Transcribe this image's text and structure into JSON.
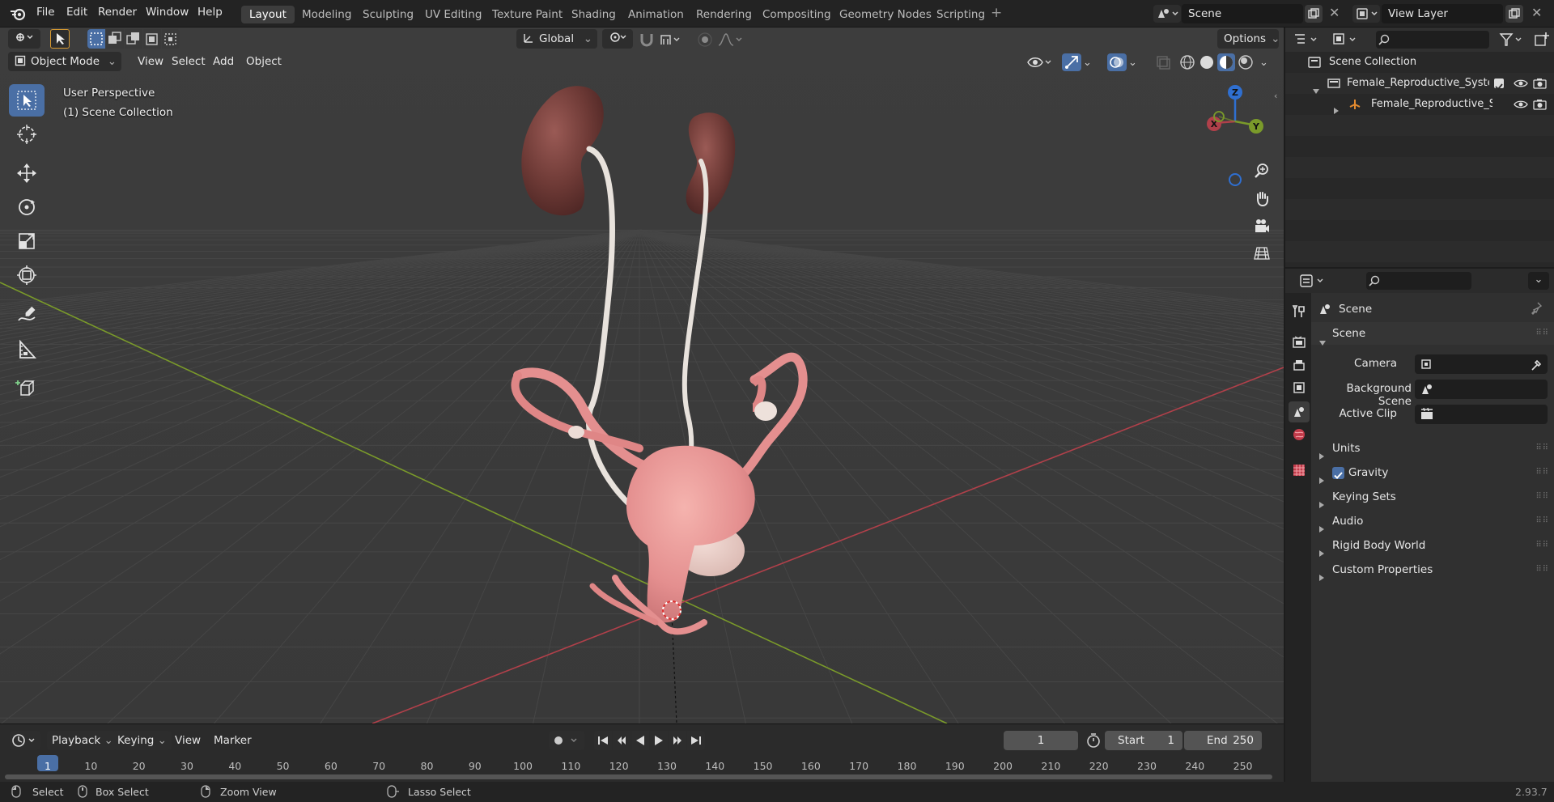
{
  "menu": {
    "items": [
      "File",
      "Edit",
      "Render",
      "Window",
      "Help"
    ]
  },
  "workspaces": {
    "tabs": [
      "Layout",
      "Modeling",
      "Sculpting",
      "UV Editing",
      "Texture Paint",
      "Shading",
      "Animation",
      "Rendering",
      "Compositing",
      "Geometry Nodes",
      "Scripting"
    ],
    "active": "Layout"
  },
  "scene_selector": {
    "value": "Scene"
  },
  "view_layer_selector": {
    "value": "View Layer"
  },
  "viewport": {
    "mode": "Object Mode",
    "menus": [
      "View",
      "Select",
      "Add",
      "Object"
    ],
    "transform_orientation": "Global",
    "options_label": "Options",
    "overlay_line1": "User Perspective",
    "overlay_line2": "(1) Scene Collection",
    "gizmo_axes": {
      "z": "Z",
      "y": "Y",
      "x": "X"
    }
  },
  "outliner": {
    "root": "Scene Collection",
    "rows": [
      {
        "label": "Female_Reproductive_Syster",
        "indent": 1
      },
      {
        "label": "Female_Reproductive_Sy",
        "indent": 2
      }
    ]
  },
  "properties": {
    "context_label": "Scene",
    "panel_title": "Scene",
    "fields": [
      {
        "label": "Camera"
      },
      {
        "label": "Background Scene"
      },
      {
        "label": "Active Clip"
      }
    ],
    "subpanels": [
      "Units",
      "Gravity",
      "Keying Sets",
      "Audio",
      "Rigid Body World",
      "Custom Properties"
    ],
    "gravity_checked": true
  },
  "timeline": {
    "menus": [
      "Playback",
      "Keying",
      "View",
      "Marker"
    ],
    "current_frame": "1",
    "start_label": "Start",
    "start_value": "1",
    "end_label": "End",
    "end_value": "250",
    "ruler_marks": [
      "1",
      "10",
      "20",
      "30",
      "40",
      "50",
      "60",
      "70",
      "80",
      "90",
      "100",
      "110",
      "120",
      "130",
      "140",
      "150",
      "160",
      "170",
      "180",
      "190",
      "200",
      "210",
      "220",
      "230",
      "240",
      "250"
    ]
  },
  "statusbar": {
    "select": "Select",
    "box_select": "Box Select",
    "zoom_view": "Zoom View",
    "lasso_select": "Lasso Select",
    "version": "2.93.7"
  },
  "colors": {
    "accent_blue": "#4a6fa5",
    "x_axis": "#b0404a",
    "y_axis": "#7a9a2a",
    "z_axis": "#2f6fd0",
    "organ_pink": "#e48f8f",
    "kidney": "#7a3f3a"
  }
}
